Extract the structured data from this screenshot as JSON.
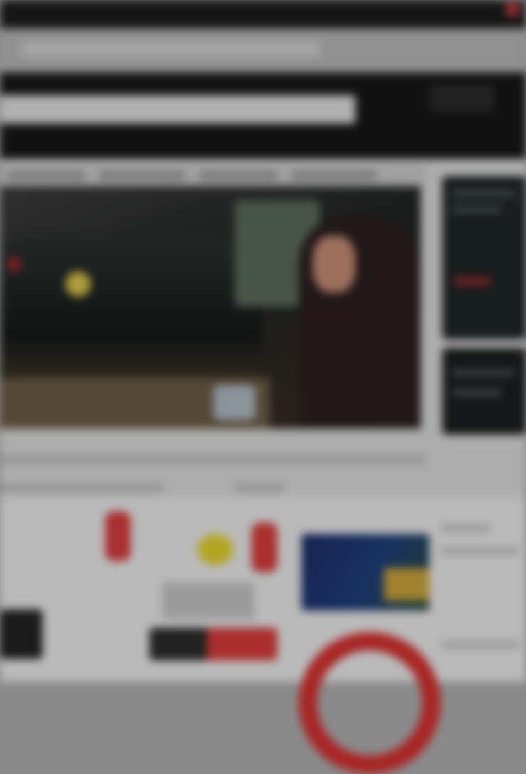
{
  "browser": {
    "url_text": ""
  },
  "header": {
    "headline": "",
    "button_label": ""
  },
  "nav": {
    "items": [
      "",
      "",
      "",
      ""
    ]
  },
  "hero": {
    "caption": ""
  },
  "sidebar": {
    "cards": [
      "",
      ""
    ]
  },
  "ad": {
    "promo_text": "",
    "banner_text": ""
  },
  "colors": {
    "header_bg": "#161616",
    "content_bg": "#d8d8d8",
    "accent_red": "#d43b3b",
    "accent_yellow": "#e0cf2b",
    "promo_blue": "#1e3e7a"
  },
  "icons": [
    "close-icon"
  ]
}
